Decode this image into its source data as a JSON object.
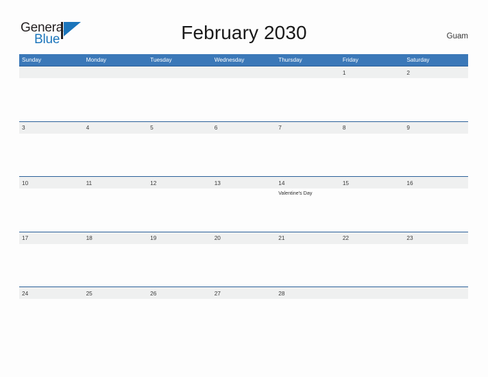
{
  "brand": {
    "name_top": "General",
    "name_bottom": "Blue",
    "flag_icon": "flag-icon",
    "accent_color": "#1b75bb"
  },
  "header": {
    "title": "February 2030",
    "location": "Guam"
  },
  "theme": {
    "header_row_bg": "#3b78b8",
    "week_band_bg": "#eff0f0",
    "row_divider": "#2a6099",
    "page_bg": "#fdfdfd",
    "header_text": "#ffffff",
    "date_text": "#3a3a3a"
  },
  "calendar": {
    "month": "February",
    "year": "2030",
    "weekdays": [
      "Sunday",
      "Monday",
      "Tuesday",
      "Wednesday",
      "Thursday",
      "Friday",
      "Saturday"
    ],
    "weeks": [
      [
        {
          "date": "",
          "event": ""
        },
        {
          "date": "",
          "event": ""
        },
        {
          "date": "",
          "event": ""
        },
        {
          "date": "",
          "event": ""
        },
        {
          "date": "",
          "event": ""
        },
        {
          "date": "1",
          "event": ""
        },
        {
          "date": "2",
          "event": ""
        }
      ],
      [
        {
          "date": "3",
          "event": ""
        },
        {
          "date": "4",
          "event": ""
        },
        {
          "date": "5",
          "event": ""
        },
        {
          "date": "6",
          "event": ""
        },
        {
          "date": "7",
          "event": ""
        },
        {
          "date": "8",
          "event": ""
        },
        {
          "date": "9",
          "event": ""
        }
      ],
      [
        {
          "date": "10",
          "event": ""
        },
        {
          "date": "11",
          "event": ""
        },
        {
          "date": "12",
          "event": ""
        },
        {
          "date": "13",
          "event": ""
        },
        {
          "date": "14",
          "event": "Valentine's Day"
        },
        {
          "date": "15",
          "event": ""
        },
        {
          "date": "16",
          "event": ""
        }
      ],
      [
        {
          "date": "17",
          "event": ""
        },
        {
          "date": "18",
          "event": ""
        },
        {
          "date": "19",
          "event": ""
        },
        {
          "date": "20",
          "event": ""
        },
        {
          "date": "21",
          "event": ""
        },
        {
          "date": "22",
          "event": ""
        },
        {
          "date": "23",
          "event": ""
        }
      ],
      [
        {
          "date": "24",
          "event": ""
        },
        {
          "date": "25",
          "event": ""
        },
        {
          "date": "26",
          "event": ""
        },
        {
          "date": "27",
          "event": ""
        },
        {
          "date": "28",
          "event": ""
        },
        {
          "date": "",
          "event": ""
        },
        {
          "date": "",
          "event": ""
        }
      ]
    ]
  }
}
